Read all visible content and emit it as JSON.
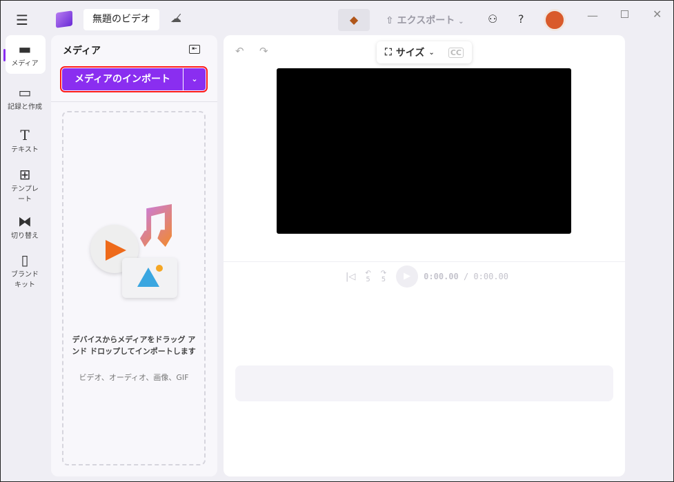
{
  "header": {
    "title": "無題のビデオ",
    "export_label": "エクスポート"
  },
  "sidebar": {
    "items": [
      {
        "label": "メディア"
      },
      {
        "label": "記録と作成"
      },
      {
        "label": "テキスト"
      },
      {
        "label": "テンプレート"
      },
      {
        "label": "切り替え"
      },
      {
        "label": "ブランドキット"
      }
    ]
  },
  "media_panel": {
    "title": "メディア",
    "import_label": "メディアのインポート",
    "drop_text": "デバイスからメディアをドラッグ アンド ドロップしてインポートします",
    "drop_subtext": "ビデオ、オーディオ、画像、GIF"
  },
  "preview": {
    "size_label": "サイズ",
    "rewind_seconds": "5",
    "forward_seconds": "5",
    "current_time": "0:00.00",
    "total_time": "/ 0:00.00"
  },
  "colors": {
    "accent": "#8a2ef0",
    "highlight": "#ff1a1a"
  }
}
